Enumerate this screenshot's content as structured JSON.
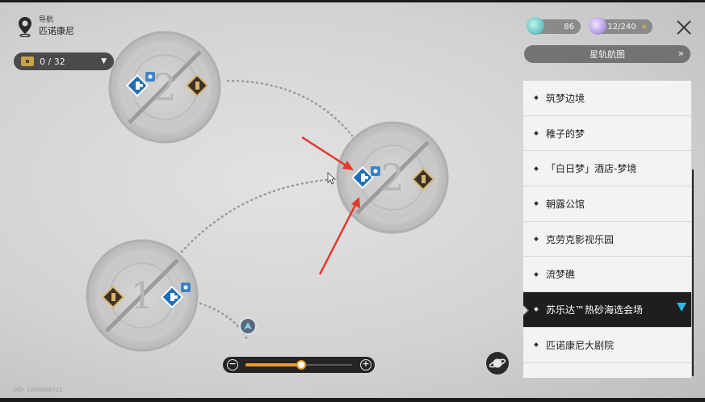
{
  "nav": {
    "title": "导航",
    "location": "匹诺康尼"
  },
  "chest": {
    "count": "0 / 32"
  },
  "currencies": [
    {
      "name": "trailblaze-power",
      "value": "86"
    },
    {
      "name": "reserved-power",
      "value": "12/240"
    }
  ],
  "currency_plus": "+",
  "starmap_button": {
    "label": "星轨航图",
    "chevron": "»"
  },
  "locations": [
    {
      "label": "筑梦边境",
      "active": false
    },
    {
      "label": "稚子的梦",
      "active": false
    },
    {
      "label": "「白日梦」酒店-梦境",
      "active": false
    },
    {
      "label": "朝露公馆",
      "active": false
    },
    {
      "label": "克劳克影视乐园",
      "active": false
    },
    {
      "label": "流梦礁",
      "active": false
    },
    {
      "label": "苏乐达™热砂海选会场",
      "active": true
    },
    {
      "label": "匹诺康尼大剧院",
      "active": false
    }
  ],
  "zoom": {
    "minus": "−",
    "plus": "+",
    "level": 0.52
  },
  "map_floors": [
    {
      "name": "floor-2-upper-left",
      "numeral": "2"
    },
    {
      "name": "floor-2-center-right",
      "numeral": "2"
    },
    {
      "name": "floor-1-lower-left",
      "numeral": "1"
    }
  ],
  "uid": "UID: 1000000712",
  "colors": {
    "accent_orange": "#e89a2f",
    "selection_blue": "#29b9e8",
    "annotation_red": "#e23a2e",
    "teleport_blue": "#1f6fb8",
    "gold_marker": "#b98a3b"
  },
  "icons": {
    "nav": "map-pin-icon",
    "chest": "treasure-chest-icon",
    "close": "close-icon",
    "planet": "planet-icon",
    "player": "player-arrow-icon"
  }
}
